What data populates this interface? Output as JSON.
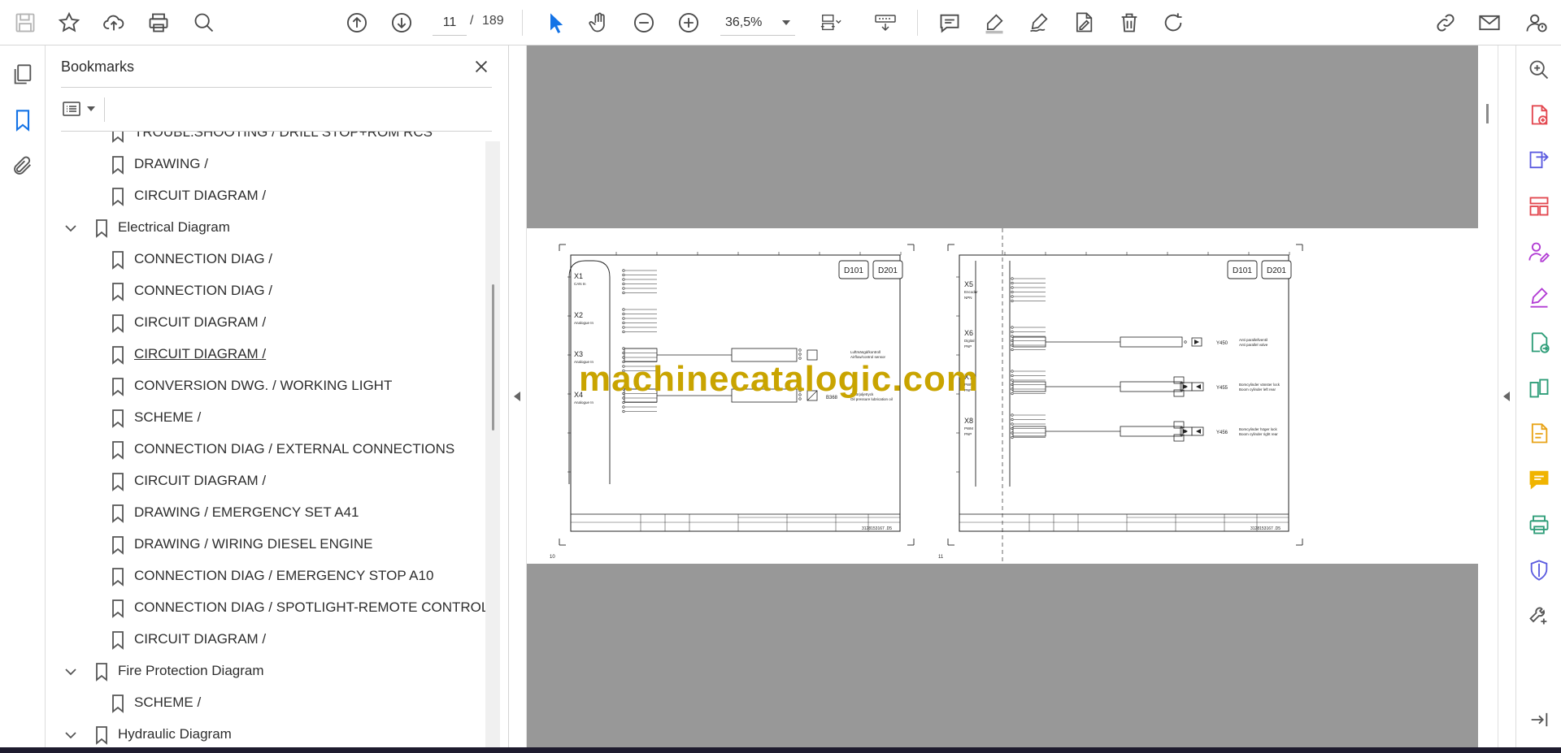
{
  "toolbar": {
    "page_current": "11",
    "page_separator": "/",
    "page_total": "189",
    "zoom": "36,5%"
  },
  "bookmarks": {
    "title": "Bookmarks",
    "items": [
      {
        "label": "TROUBL.SHOOTING / DRILL STOP+ROM RCS",
        "level": 2
      },
      {
        "label": "DRAWING /",
        "level": 2
      },
      {
        "label": "CIRCUIT DIAGRAM /",
        "level": 2
      },
      {
        "label": "Electrical Diagram",
        "level": 1,
        "expanded": true
      },
      {
        "label": "CONNECTION DIAG /",
        "level": 2
      },
      {
        "label": "CONNECTION DIAG /",
        "level": 2
      },
      {
        "label": "CIRCUIT DIAGRAM /",
        "level": 2
      },
      {
        "label": "CIRCUIT DIAGRAM /",
        "level": 2,
        "hovered": true
      },
      {
        "label": "CONVERSION DWG. / WORKING LIGHT",
        "level": 2
      },
      {
        "label": "SCHEME /",
        "level": 2
      },
      {
        "label": "CONNECTION DIAG / EXTERNAL CONNECTIONS",
        "level": 2
      },
      {
        "label": "CIRCUIT DIAGRAM /",
        "level": 2
      },
      {
        "label": "DRAWING / EMERGENCY SET A41",
        "level": 2
      },
      {
        "label": "DRAWING / WIRING DIESEL ENGINE",
        "level": 2
      },
      {
        "label": "CONNECTION DIAG / EMERGENCY STOP A10",
        "level": 2
      },
      {
        "label": "CONNECTION DIAG / SPOTLIGHT-REMOTE CONTROL",
        "level": 2
      },
      {
        "label": "CIRCUIT DIAGRAM /",
        "level": 2
      },
      {
        "label": "Fire Protection Diagram",
        "level": 1,
        "expanded": true
      },
      {
        "label": "SCHEME /",
        "level": 2
      },
      {
        "label": "Hydraulic Diagram",
        "level": 1,
        "expanded": true
      }
    ]
  },
  "document": {
    "watermark": "machinecatalogic.com",
    "left_page": {
      "number": "10",
      "tags": [
        "D101",
        "D201"
      ],
      "connectors": [
        {
          "id": "X1",
          "desc": "CAN In"
        },
        {
          "id": "X2",
          "desc": "Analogue In"
        },
        {
          "id": "X3",
          "desc": "Analogue In"
        },
        {
          "id": "X4",
          "desc": "Analogue In"
        }
      ],
      "component_label": "B368",
      "component_desc_1": "Smörjoljetryck",
      "component_desc_2": "Oil pressure lubrication oil",
      "mid_desc_1": "Luftmängd/kontroll",
      "mid_desc_2": "Airflow/control sensor",
      "drawing_no": "3128153167 .D5"
    },
    "right_page": {
      "number": "11",
      "tags": [
        "D101",
        "D201"
      ],
      "connectors": [
        {
          "id": "X5",
          "desc": "Encoder",
          "desc2": "NPN"
        },
        {
          "id": "X6",
          "desc": "Digital",
          "desc2": "PNP"
        },
        {
          "id": "X7",
          "desc": "PWM",
          "desc2": "PNP"
        },
        {
          "id": "X8",
          "desc": "PWM",
          "desc2": "PNP"
        }
      ],
      "outputs": [
        {
          "id": "Y450",
          "desc1": "Anti parallellventil",
          "desc2": "Anti parallel valve"
        },
        {
          "id": "Y455",
          "desc1": "Bomcylinder vänster lock",
          "desc2": "Boom cylinder left rear"
        },
        {
          "id": "Y456",
          "desc1": "Bomcylinder höger lock",
          "desc2": "Boom cylinder right rear"
        }
      ],
      "drawing_no": "3128153167 .D5"
    }
  },
  "colors": {
    "accent": "#1473e6",
    "viewport_bg": "#989898",
    "watermark": "#c9a400"
  }
}
